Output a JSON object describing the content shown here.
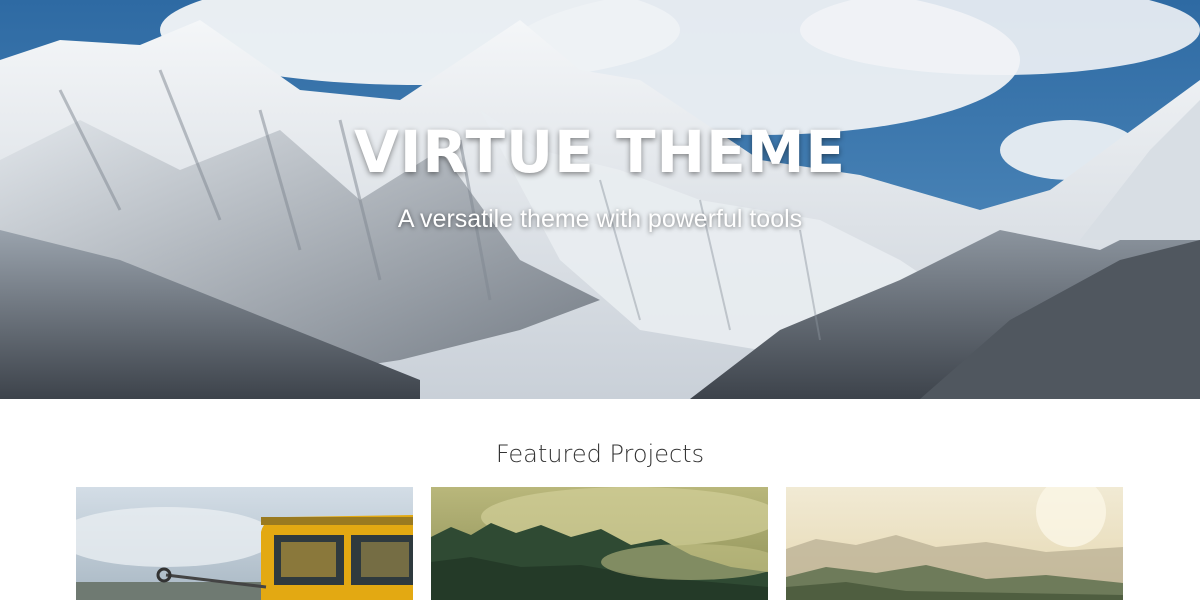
{
  "hero": {
    "title": "VIRTUE THEME",
    "subtitle": "A versatile theme with powerful tools"
  },
  "featured": {
    "title": "Featured Projects"
  },
  "colors": {
    "sky": "#3c7ab0",
    "snow": "#eef1f3",
    "rock": "#4a5058",
    "text_dark": "#333333"
  },
  "icons": {
    "hero_image": "snowy-mountains-image",
    "card_1": "yellow-bus-image",
    "card_2": "misty-forest-image",
    "card_3": "hazy-hills-image"
  }
}
